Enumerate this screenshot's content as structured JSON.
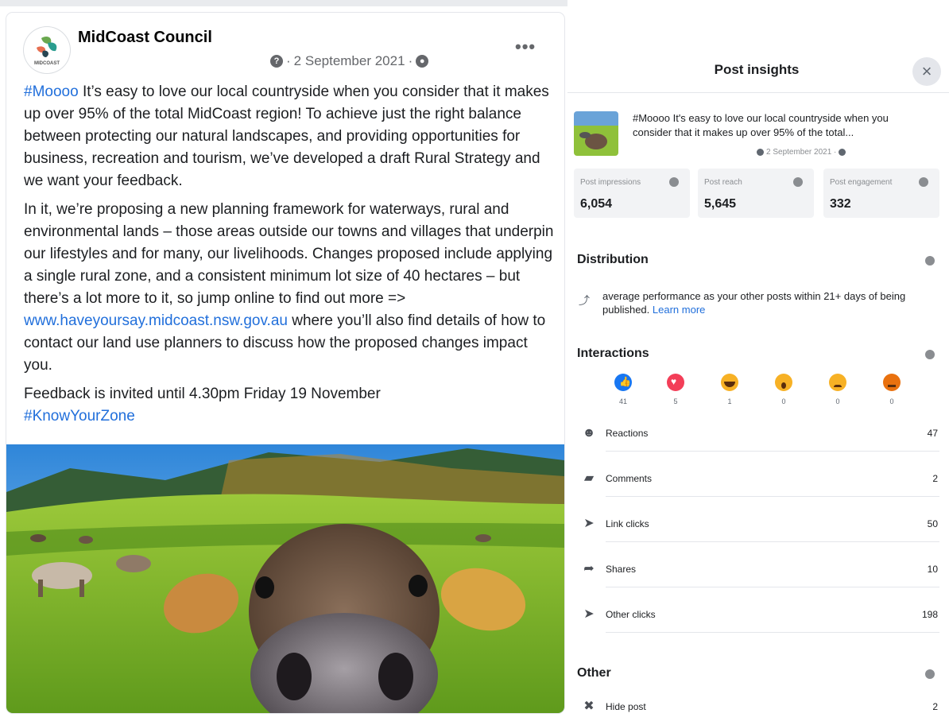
{
  "post": {
    "page_name": "MidCoast Council",
    "avatar_caption": "MIDCOAST",
    "date": "2 September 2021",
    "more_label": "•••",
    "p1_tag": "#Moooo",
    "p1_text": " It’s easy to love our local countryside when you consider that it makes up over 95% of the total MidCoast region! To achieve just the right balance between protecting our natural landscapes, and providing opportunities for business, recreation and tourism, we’ve developed a draft Rural Strategy and we want your feedback.",
    "p2_text": "In it, we’re proposing a new planning framework for waterways, rural and environmental lands – those areas outside our towns and villages that underpin our lifestyles and for many, our livelihoods.  Changes proposed include applying a single rural zone, and a consistent minimum lot size of 40 hectares – but there’s a lot more to it, so jump online to find out more => ",
    "p2_link": "www.haveyoursay.midcoast.nsw.gov.au",
    "p2_tail": " where you’ll also find details of how to contact our land use planners to discuss how the proposed changes impact you.",
    "p3_text": "Feedback is invited until 4.30pm Friday 19 November",
    "p3_tag": "#KnowYourZone"
  },
  "insights": {
    "title": "Post insights",
    "close_label": "×",
    "preview_text": "#Moooo It's easy to love our local countryside when you consider that it makes up over 95% of the total...",
    "preview_date": "2 September 2021 ·",
    "stats": [
      {
        "label": "Post impressions",
        "value": "6,054"
      },
      {
        "label": "Post reach",
        "value": "5,645"
      },
      {
        "label": "Post engagement",
        "value": "332"
      }
    ],
    "distribution": {
      "title": "Distribution",
      "text": "average performance as your other posts within 21+ days of being published.",
      "link": "Learn more"
    },
    "interactions": {
      "title": "Interactions",
      "reactions": [
        {
          "name": "like",
          "count": "41",
          "color": "#1877f2"
        },
        {
          "name": "love",
          "count": "5",
          "color": "#f33e58"
        },
        {
          "name": "haha",
          "count": "1",
          "color": "#f7b125"
        },
        {
          "name": "wow",
          "count": "0",
          "color": "#f7b125"
        },
        {
          "name": "sad",
          "count": "0",
          "color": "#f7b125"
        },
        {
          "name": "angry",
          "count": "0",
          "color": "#e9710f"
        }
      ],
      "metrics": [
        {
          "icon": "smiley-icon",
          "glyph": "☻",
          "label": "Reactions",
          "value": "47"
        },
        {
          "icon": "comment-icon",
          "glyph": "▰",
          "label": "Comments",
          "value": "2"
        },
        {
          "icon": "cursor-icon",
          "glyph": "➤",
          "label": "Link clicks",
          "value": "50"
        },
        {
          "icon": "share-icon",
          "glyph": "➦",
          "label": "Shares",
          "value": "10"
        },
        {
          "icon": "cursor-icon",
          "glyph": "➤",
          "label": "Other clicks",
          "value": "198"
        }
      ]
    },
    "other": {
      "title": "Other",
      "metrics": [
        {
          "icon": "hide-icon",
          "glyph": "✖",
          "label": "Hide post",
          "value": "2"
        }
      ]
    }
  }
}
